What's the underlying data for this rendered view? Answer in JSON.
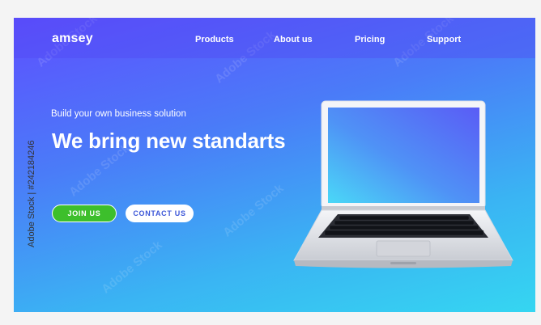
{
  "nav": {
    "logo": "amsey",
    "items": [
      {
        "label": "Products"
      },
      {
        "label": "About us"
      },
      {
        "label": "Pricing"
      },
      {
        "label": "Support"
      }
    ]
  },
  "hero": {
    "subtitle": "Build your own business solution",
    "headline": "We bring new standarts",
    "join_label": "JOIN US",
    "contact_label": "CONTACT US"
  },
  "watermark": {
    "vertical_text": "Adobe Stock | #242184246",
    "tile_text": "Adobe Stock"
  },
  "colors": {
    "gradient_top": "#5e4fff",
    "gradient_bottom": "#35d6f1",
    "join_button": "#3dbf2c",
    "contact_text": "#3d57d8"
  }
}
